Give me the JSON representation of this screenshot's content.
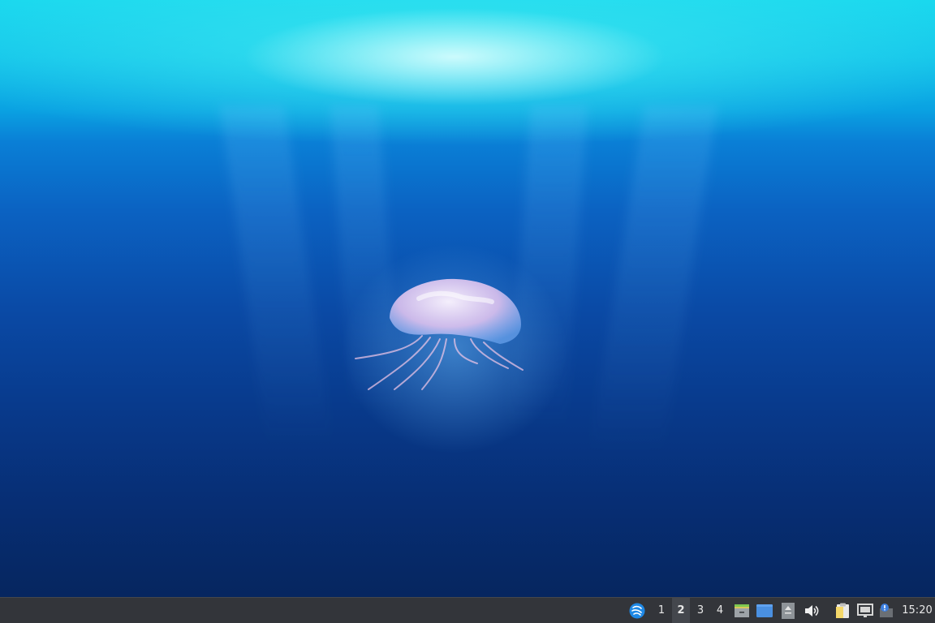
{
  "desktop": {
    "wallpaper": "underwater-jellyfish",
    "colors": {
      "surface": "#19d8ee",
      "deep": "#06265f",
      "jelly": "#f2d6ff"
    }
  },
  "taskbar": {
    "background": "#33353a",
    "workspaces": [
      {
        "label": "1",
        "active": false
      },
      {
        "label": "2",
        "active": true
      },
      {
        "label": "3",
        "active": false
      },
      {
        "label": "4",
        "active": false
      }
    ],
    "tray_icons": [
      "app-menu-icon",
      "file-manager-icon",
      "window-icon",
      "updates-icon",
      "volume-icon",
      "clipboard-icon",
      "network-icon",
      "notification-icon"
    ],
    "clock": "15:20"
  }
}
